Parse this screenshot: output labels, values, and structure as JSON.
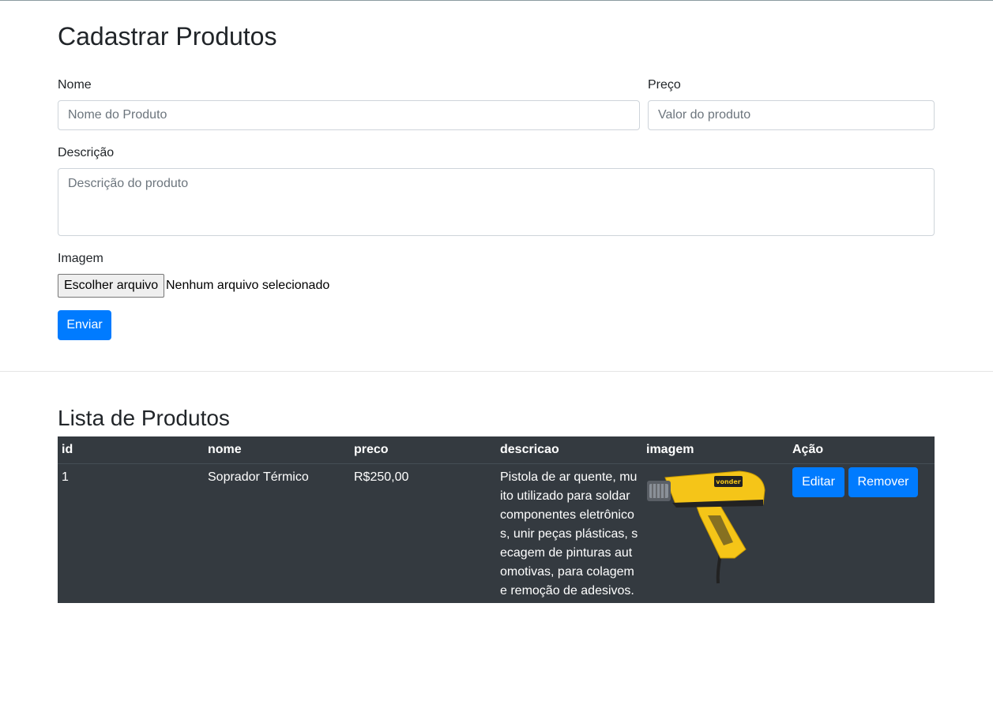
{
  "form": {
    "title": "Cadastrar Produtos",
    "name_label": "Nome",
    "name_placeholder": "Nome do Produto",
    "price_label": "Preço",
    "price_placeholder": "Valor do produto",
    "description_label": "Descrição",
    "description_placeholder": "Descrição do produto",
    "image_label": "Imagem",
    "file_button": "Escolher arquivo",
    "file_status": "Nenhum arquivo selecionado",
    "submit_label": "Enviar"
  },
  "list": {
    "title": "Lista de Produtos",
    "columns": [
      "id",
      "nome",
      "preco",
      "descricao",
      "imagem",
      "Ação"
    ],
    "rows": [
      {
        "id": "1",
        "nome": "Soprador Térmico",
        "preco": "R$250,00",
        "descricao": "Pistola de ar quente, muito utilizado para soldar componentes eletrônicos, unir peças plásticas, secagem de pinturas automotivas, para colagem e remoção de adesivos.",
        "image_brand": "vonder",
        "edit_label": "Editar",
        "remove_label": "Remover"
      }
    ]
  },
  "colors": {
    "primary": "#007bff",
    "table_dark": "#343a40",
    "product_yellow": "#f5c518"
  }
}
